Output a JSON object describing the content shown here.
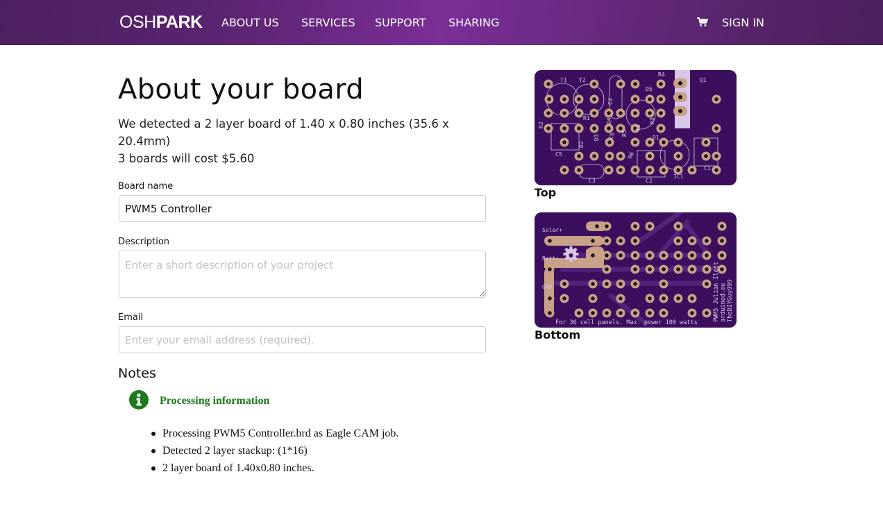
{
  "nav": {
    "logo_light": "OSH",
    "logo_bold": "PARK",
    "links": [
      "ABOUT US",
      "SERVICES",
      "SUPPORT",
      "SHARING"
    ],
    "cart_icon": "shopping-cart-icon",
    "sign_in": "SIGN IN"
  },
  "main": {
    "title": "About your board",
    "detection": "We detected a 2 layer board of 1.40 x 0.80 inches (35.6 x 20.4mm)",
    "cost": "3 boards will cost $5.60",
    "form": {
      "board_name_label": "Board name",
      "board_name_value": "PWM5 Controller",
      "description_label": "Description",
      "description_placeholder": "Enter a short description of your project",
      "email_label": "Email",
      "email_placeholder": "Enter your email address (required)."
    },
    "notes": {
      "title": "Notes",
      "info_icon": "info-circle-icon",
      "info_title": "Processing information",
      "info_color": "#1d7a1d",
      "items": [
        "Processing PWM5 Controller.brd as Eagle CAM job.",
        "Detected 2 layer stackup: (1*16)",
        "2 layer board of 1.40x0.80 inches."
      ]
    }
  },
  "previews": {
    "top_caption": "Top",
    "bottom_caption": "Bottom",
    "board_color": "#3b0f5e",
    "pad_color": "#c9a088",
    "silk_color": "#d8c6e6",
    "top_labels": [
      "T1",
      "T2",
      "C4",
      "D5",
      "R4",
      "Q1",
      "R1",
      "R2",
      "D4",
      "T3",
      "R3",
      "D2",
      "D3",
      "C6",
      "R5",
      "D1",
      "C5",
      "R6",
      "C1",
      "C3",
      "C2",
      "IC1"
    ],
    "bottom_labels": [
      "Solar+",
      "Batt+",
      "GND"
    ],
    "bottom_footer": "For 36 cell panels. Max. power 100 watts",
    "bottom_side_text": [
      "PWM5 Julian Ilett",
      "arduined.eu",
      "TheDIYGuy999"
    ]
  }
}
